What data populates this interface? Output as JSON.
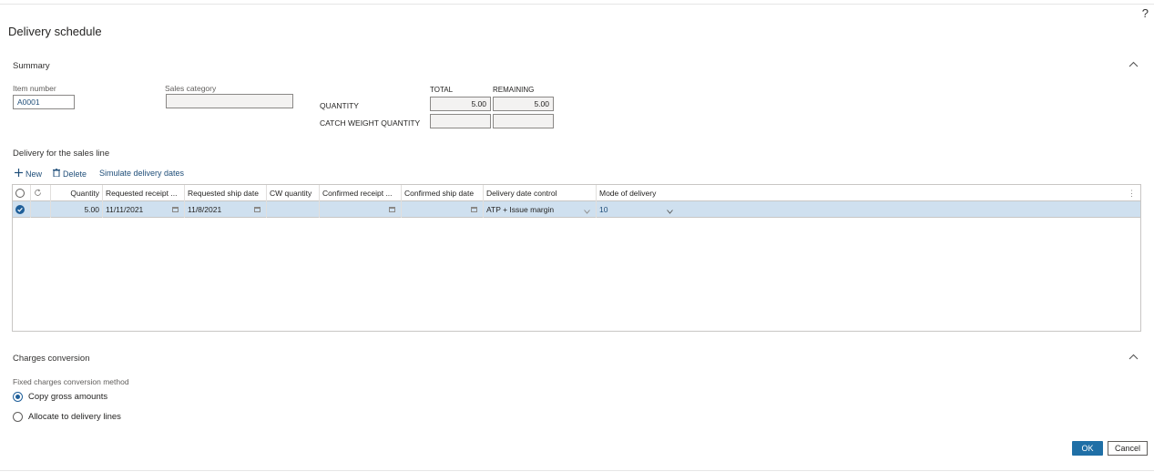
{
  "window": {
    "help_label": "?",
    "title": "Delivery schedule"
  },
  "summary": {
    "title": "Summary",
    "item_number_label": "Item number",
    "item_number_value": "A0001",
    "sales_category_label": "Sales category",
    "sales_category_value": "",
    "total_header": "TOTAL",
    "remaining_header": "REMAINING",
    "quantity_label": "QUANTITY",
    "quantity_total": "5.00",
    "quantity_remaining": "5.00",
    "cw_quantity_label": "CATCH WEIGHT QUANTITY",
    "cw_quantity_total": "",
    "cw_quantity_remaining": ""
  },
  "delivery": {
    "title": "Delivery for the sales line",
    "toolbar": {
      "new_label": "New",
      "delete_label": "Delete",
      "simulate_label": "Simulate delivery dates"
    },
    "columns": [
      "Quantity",
      "Requested receipt ...",
      "Requested ship date",
      "CW quantity",
      "Confirmed receipt ...",
      "Confirmed ship date",
      "Delivery date control",
      "Mode of delivery"
    ],
    "rows": [
      {
        "quantity": "5.00",
        "requested_receipt": "11/11/2021",
        "requested_ship": "11/8/2021",
        "cw_quantity": "",
        "confirmed_receipt": "",
        "confirmed_ship": "",
        "delivery_date_control": "ATP + Issue margin",
        "mode_of_delivery": "10"
      }
    ]
  },
  "charges": {
    "title": "Charges conversion",
    "method_label": "Fixed charges conversion method",
    "options": [
      "Copy gross amounts",
      "Allocate to delivery lines"
    ],
    "selected_index": 0
  },
  "footer": {
    "ok_label": "OK",
    "cancel_label": "Cancel"
  },
  "colors": {
    "accent": "#1f6fa6",
    "selected_row": "#cfe0ef"
  }
}
